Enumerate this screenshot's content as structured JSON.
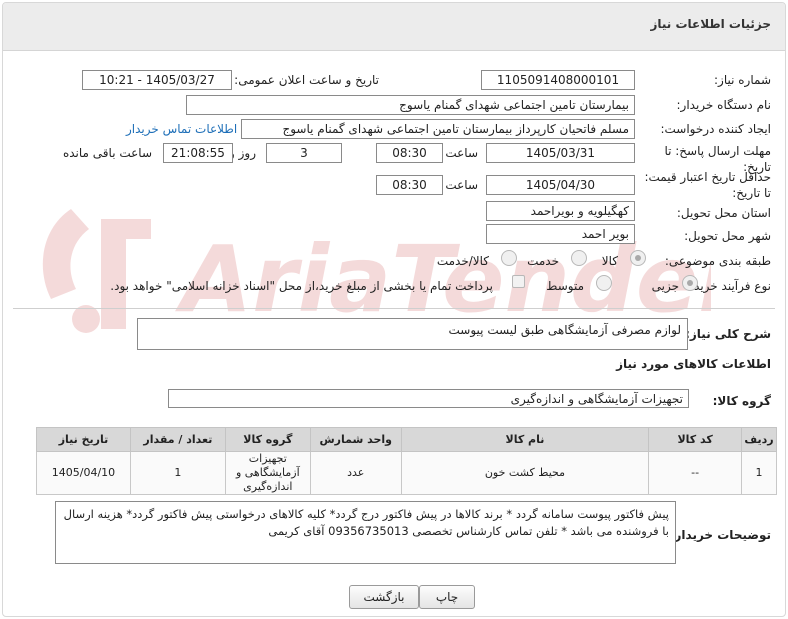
{
  "header": {
    "title": "جزئیات اطلاعات نیاز"
  },
  "form": {
    "need_number_label": "شماره نیاز:",
    "need_number": "1105091408000101",
    "announce_label": "تاریخ و ساعت اعلان عمومی:",
    "announce_value": "1405/03/27 - 10:21",
    "buyer_org_label": "نام دستگاه خریدار:",
    "buyer_org": "بیمارستان تامین اجتماعی شهدای گمنام یاسوج",
    "requester_label": "ایجاد کننده درخواست:",
    "requester": "مسلم فاتحیان کارپرداز بیمارستان تامین اجتماعی شهدای گمنام یاسوج",
    "buyer_contact_link": "اطلاعات تماس خریدار",
    "reply_deadline_label": "مهلت ارسال پاسخ: تا تاریخ:",
    "reply_date": "1405/03/31",
    "time_label": "ساعت",
    "reply_time": "08:30",
    "days_value": "3",
    "days_label": "روز و",
    "remaining_time": "21:08:55",
    "remaining_label": "ساعت باقی مانده",
    "validity_label": "حداقل تاریخ اعتبار قیمت: تا تاریخ:",
    "validity_date": "1405/04/30",
    "validity_time": "08:30",
    "province_label": "استان محل تحویل:",
    "province": "کهگیلویه و بویراحمد",
    "city_label": "شهر محل تحویل:",
    "city": "بویر احمد",
    "category_label": "طبقه بندی موضوعی:",
    "category_options": [
      "کالا",
      "خدمت",
      "کالا/خدمت"
    ],
    "process_label": "نوع فرآیند خرید :",
    "process_options": [
      "جزیی",
      "متوسط"
    ],
    "payment_note": "پرداخت تمام یا بخشی از مبلغ خرید،از محل \"اسناد خزانه اسلامی\" خواهد بود."
  },
  "summary": {
    "label": "شرح کلی نیاز:",
    "value": "لوازم مصرفی آزمایشگاهی طبق لیست پیوست"
  },
  "goods": {
    "section_title": "اطلاعات کالاهای مورد نیاز",
    "group_label": "گروه کالا:",
    "group_value": "تجهیزات آزمایشگاهی و اندازه‌گیری",
    "columns": [
      "ردیف",
      "کد کالا",
      "نام کالا",
      "واحد شمارش",
      "گروه کالا",
      "تعداد / مقدار",
      "تاریخ نیاز"
    ],
    "rows": [
      [
        "1",
        "--",
        "محیط کشت خون",
        "عدد",
        "تجهیزات آزمایشگاهی و اندازه‌گیری",
        "1",
        "1405/04/10"
      ]
    ]
  },
  "notes": {
    "label": "توضیحات خریدار:",
    "value": "پیش فاکتور پیوست سامانه گردد * برند کالاها در پیش فاکتور درج گردد* کلیه کالاهای درخواستی پیش فاکتور گردد* هزینه ارسال با فروشنده می باشد * تلفن تماس کارشناس تخصصی 09356735013 آقای کریمی"
  },
  "buttons": {
    "back": "بازگشت",
    "print": "چاپ"
  },
  "watermark": {
    "text": "AriaTender.neT"
  }
}
